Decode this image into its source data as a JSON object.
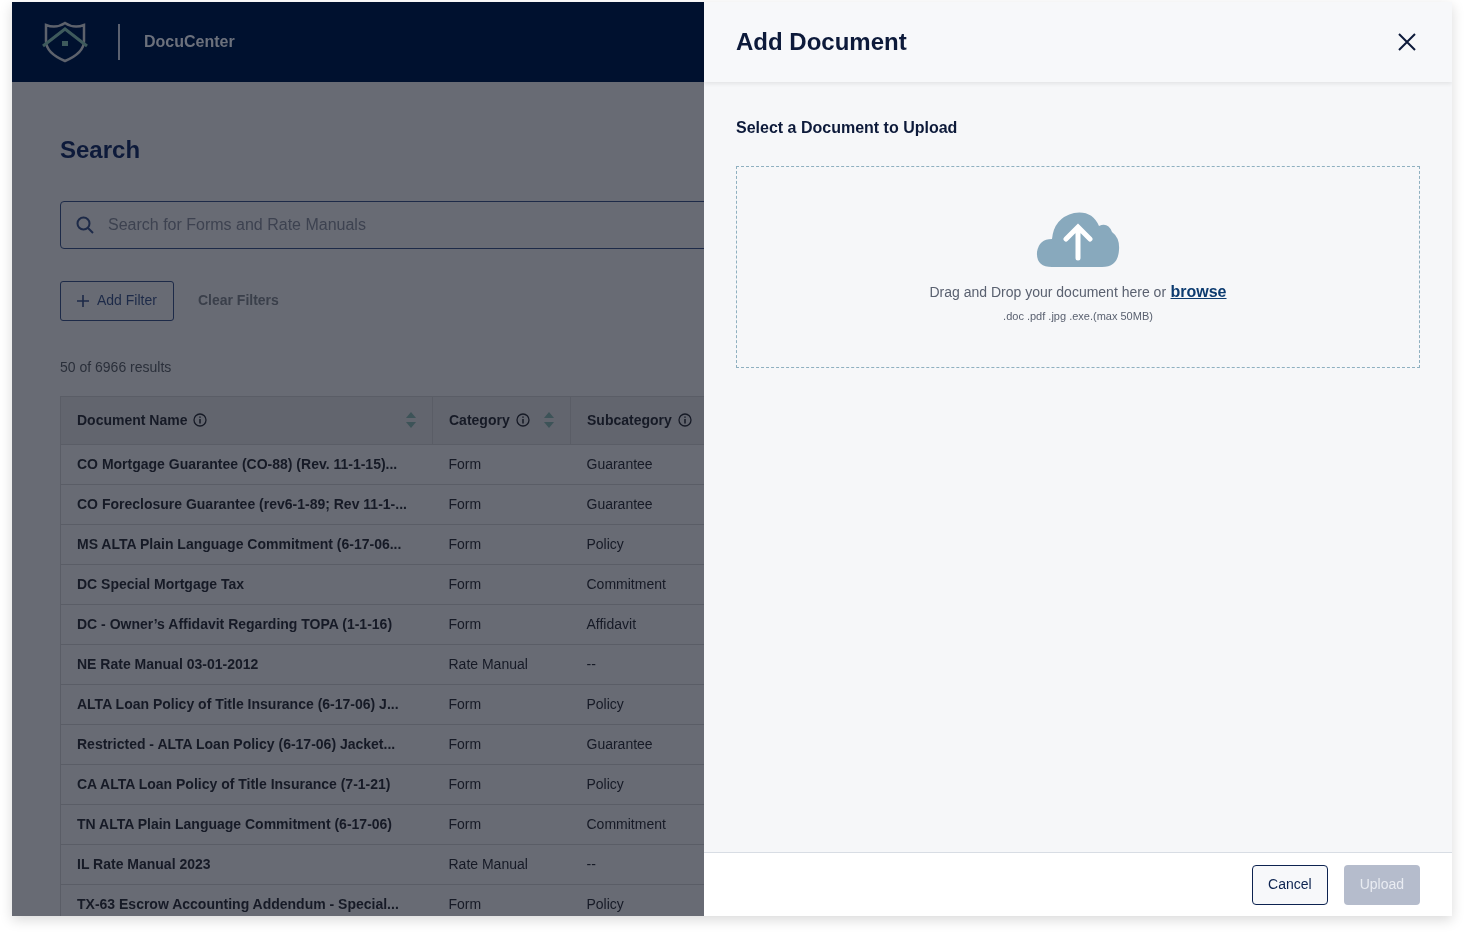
{
  "header": {
    "brand": "DocuCenter"
  },
  "search": {
    "title": "Search",
    "placeholder": "Search for Forms and Rate Manuals",
    "add_filter": "Add Filter",
    "clear_filters": "Clear Filters",
    "results_count": "50 of 6966 results"
  },
  "table": {
    "columns": [
      {
        "label": "Document Name",
        "sortable": true
      },
      {
        "label": "Category",
        "sortable": true
      },
      {
        "label": "Subcategory"
      }
    ],
    "rows": [
      {
        "name": "CO Mortgage Guarantee (CO-88) (Rev. 11-1-15)...",
        "category": "Form",
        "subcategory": "Guarantee"
      },
      {
        "name": "CO Foreclosure Guarantee (rev6-1-89; Rev 11-1-...",
        "category": "Form",
        "subcategory": "Guarantee"
      },
      {
        "name": "MS ALTA Plain Language Commitment (6-17-06...",
        "category": "Form",
        "subcategory": "Policy"
      },
      {
        "name": "DC Special Mortgage Tax",
        "category": "Form",
        "subcategory": "Commitment"
      },
      {
        "name": "DC - Owner’s Affidavit Regarding TOPA (1-1-16)",
        "category": "Form",
        "subcategory": "Affidavit"
      },
      {
        "name": "NE Rate Manual 03-01-2012",
        "category": "Rate Manual",
        "subcategory": "--"
      },
      {
        "name": "ALTA Loan Policy of Title Insurance (6-17-06) J...",
        "category": "Form",
        "subcategory": "Policy"
      },
      {
        "name": "Restricted - ALTA Loan Policy (6-17-06) Jacket...",
        "category": "Form",
        "subcategory": "Guarantee"
      },
      {
        "name": "CA ALTA Loan Policy of Title Insurance (7-1-21)",
        "category": "Form",
        "subcategory": "Policy"
      },
      {
        "name": "TN ALTA Plain Language Commitment (6-17-06)",
        "category": "Form",
        "subcategory": "Commitment"
      },
      {
        "name": "IL Rate Manual 2023",
        "category": "Rate Manual",
        "subcategory": "--"
      },
      {
        "name": "TX-63 Escrow Accounting Addendum - Special...",
        "category": "Form",
        "subcategory": "Policy"
      }
    ]
  },
  "drawer": {
    "title": "Add Document",
    "section_label": "Select a Document to Upload",
    "drop_text": "Drag and Drop your document here or",
    "browse": "browse",
    "hint": ".doc .pdf .jpg .exe.(max 50MB)",
    "buttons": [
      {
        "label": "Cancel",
        "kind": "outline",
        "disabled": false
      },
      {
        "label": "Upload",
        "kind": "primary",
        "disabled": true
      }
    ]
  }
}
